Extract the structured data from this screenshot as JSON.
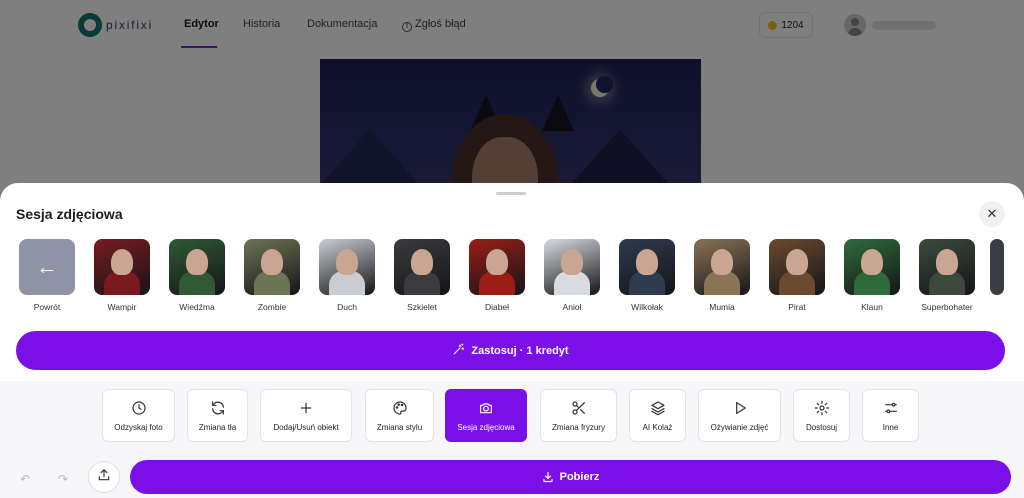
{
  "app": {
    "logo_text": "pixifixi"
  },
  "nav": {
    "links": [
      "Edytor",
      "Historia",
      "Dokumentacja",
      "Zgłoś błąd"
    ],
    "active": "Edytor",
    "credits": "1204"
  },
  "sheet": {
    "title": "Sesja zdjęciowa",
    "close_icon": "close-icon",
    "styles": [
      {
        "label": "Powrót",
        "icon": "arrow-left-icon"
      },
      {
        "label": "Wampir",
        "color": "#7a1a1f"
      },
      {
        "label": "Wiedźma",
        "color": "#2f5a34"
      },
      {
        "label": "Zombie",
        "color": "#6d7453"
      },
      {
        "label": "Duch",
        "color": "#c9cdd2"
      },
      {
        "label": "Szkielet",
        "color": "#3b3b3d"
      },
      {
        "label": "Diabeł",
        "color": "#9a1d16"
      },
      {
        "label": "Anioł",
        "color": "#d8dbe0"
      },
      {
        "label": "Wilkołak",
        "color": "#2e3b4e"
      },
      {
        "label": "Mumia",
        "color": "#8b7355"
      },
      {
        "label": "Pirat",
        "color": "#6b4a2f"
      },
      {
        "label": "Klaun",
        "color": "#2f6b3a"
      },
      {
        "label": "Superbohater",
        "color": "#3c4a3c"
      }
    ],
    "apply_label": "Zastosuj · 1 kredyt"
  },
  "toolbar": {
    "tools": [
      {
        "label": "Odzyskaj foto",
        "icon": "clock-icon"
      },
      {
        "label": "Zmiana tła",
        "icon": "refresh-icon"
      },
      {
        "label": "Dodaj/Usuń obiekt",
        "icon": "plus-icon"
      },
      {
        "label": "Zmiana stylu",
        "icon": "palette-icon"
      },
      {
        "label": "Sesja zdjęciowa",
        "icon": "camera-icon",
        "active": true
      },
      {
        "label": "Zmiana fryzury",
        "icon": "scissors-icon"
      },
      {
        "label": "AI Kolaż",
        "icon": "layers-icon"
      },
      {
        "label": "Ożywianie zdjęć",
        "icon": "play-icon"
      },
      {
        "label": "Dostosuj",
        "icon": "gear-icon"
      },
      {
        "label": "Inne",
        "icon": "sliders-icon"
      }
    ],
    "download_label": "Pobierz"
  },
  "colors": {
    "accent": "#7b0fe8",
    "nav_active_underline": "#6a2bd0"
  }
}
